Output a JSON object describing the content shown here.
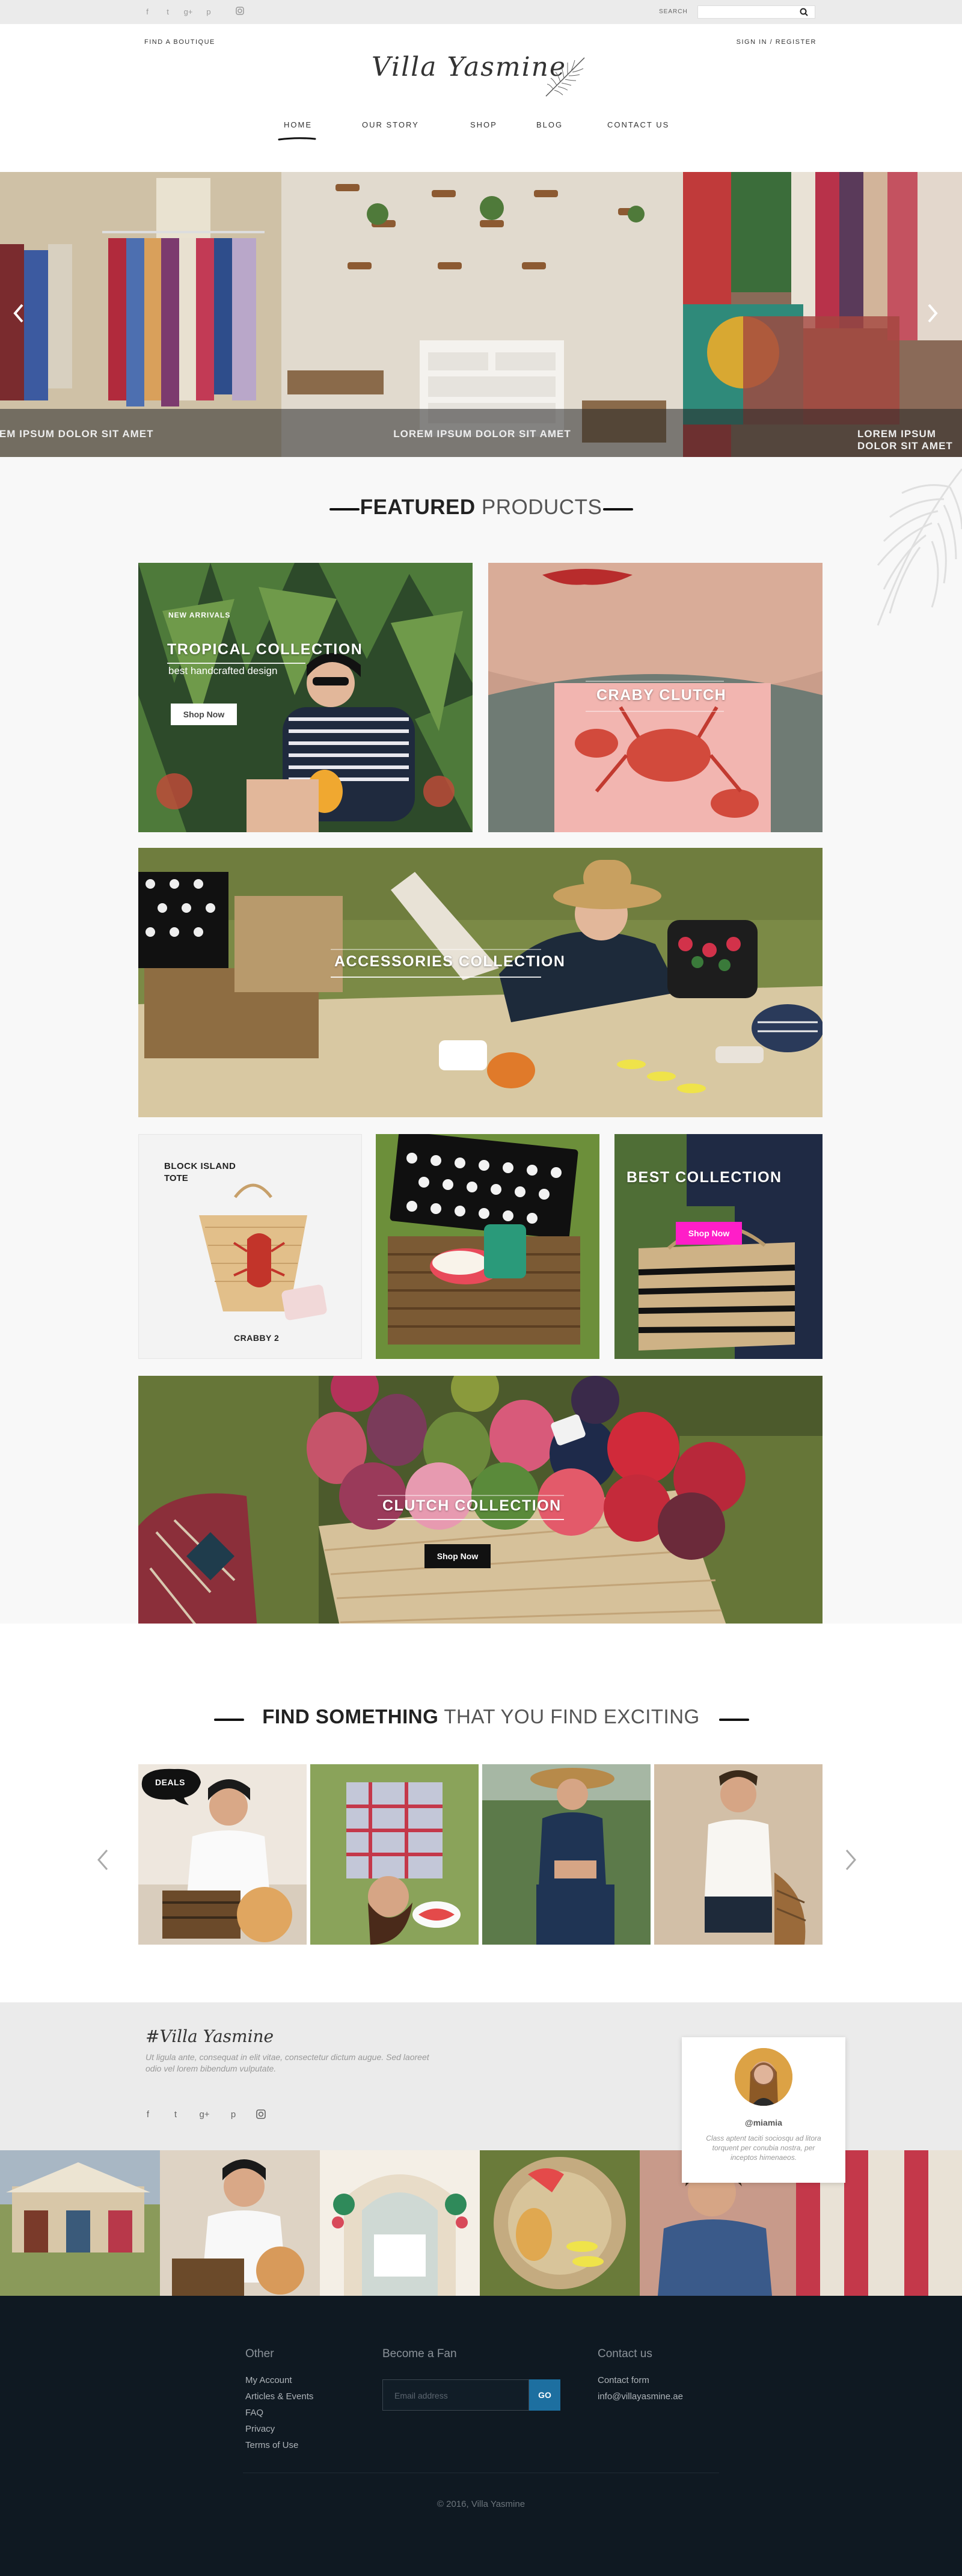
{
  "topbar": {
    "social_icons": [
      "facebook-icon",
      "twitter-icon",
      "google-plus-icon",
      "pinterest-icon",
      "instagram-icon"
    ],
    "search_label": "SEARCH",
    "search_value": ""
  },
  "header": {
    "find_boutique": "FIND A BOUTIQUE",
    "signin": "SIGN IN / REGISTER",
    "logo_text": "Villa Yasmine"
  },
  "nav": {
    "items": [
      "HOME",
      "OUR STORY",
      "SHOP",
      "BLOG",
      "CONTACT US"
    ],
    "active": "HOME"
  },
  "hero": {
    "captions": [
      "LOREM IPSUM DOLOR SIT AMET",
      "LOREM IPSUM DOLOR SIT AMET",
      "LOREM IPSUM DOLOR SIT AMET"
    ],
    "prev_icon": "chevron-left-icon",
    "next_icon": "chevron-right-icon"
  },
  "featured": {
    "title_bold": "FEATURED",
    "title_light": " PRODUCTS",
    "tile1": {
      "kicker": "NEW ARRIVALS",
      "title": "TROPICAL COLLECTION",
      "subtitle": "best handcrafted design",
      "button": "Shop Now"
    },
    "tile2": {
      "title": "CRABY CLUTCH"
    },
    "tile3": {
      "title": "ACCESSORIES COLLECTION"
    },
    "tile4": {
      "title_line1": "BLOCK ISLAND",
      "title_line2": "TOTE",
      "caption": "CRABBY 2"
    },
    "tile6": {
      "title": "BEST  COLLECTION",
      "button": "Shop Now"
    },
    "tile7": {
      "title": "CLUTCH COLLECTION",
      "button": "Shop Now"
    }
  },
  "find": {
    "title_bold": "FIND SOMETHING",
    "title_light": " THAT YOU FIND EXCITING",
    "badge": "DEALS"
  },
  "insta": {
    "title": "#Villa Yasmine",
    "description": "Ut ligula ante, consequat in elit vitae, consectetur dictum augue. Sed laoreet odio vel lorem bibendum vulputate.",
    "social_icons": [
      "facebook-icon",
      "twitter-icon",
      "google-plus-icon",
      "pinterest-icon",
      "instagram-icon"
    ],
    "profile": {
      "handle": "@miamia",
      "text": "Class aptent taciti sociosqu ad litora torquent per conubia nostra, per inceptos himenaeos."
    }
  },
  "footer": {
    "other_title": "Other",
    "other_links": [
      "My Account",
      "Articles & Events",
      "FAQ",
      "Privacy",
      "Terms of Use"
    ],
    "fan_title": "Become a Fan",
    "email_placeholder": "Email address",
    "go_label": "GO",
    "contact_title": "Contact us",
    "contact_links": [
      "Contact form",
      "info@villayasmine.ae"
    ],
    "copyright": "© 2016, Villa Yasmine"
  },
  "colors": {
    "accent_pink": "#ff1ec8",
    "footer_bg": "#0f1922",
    "go_button": "#1d6fa0"
  }
}
